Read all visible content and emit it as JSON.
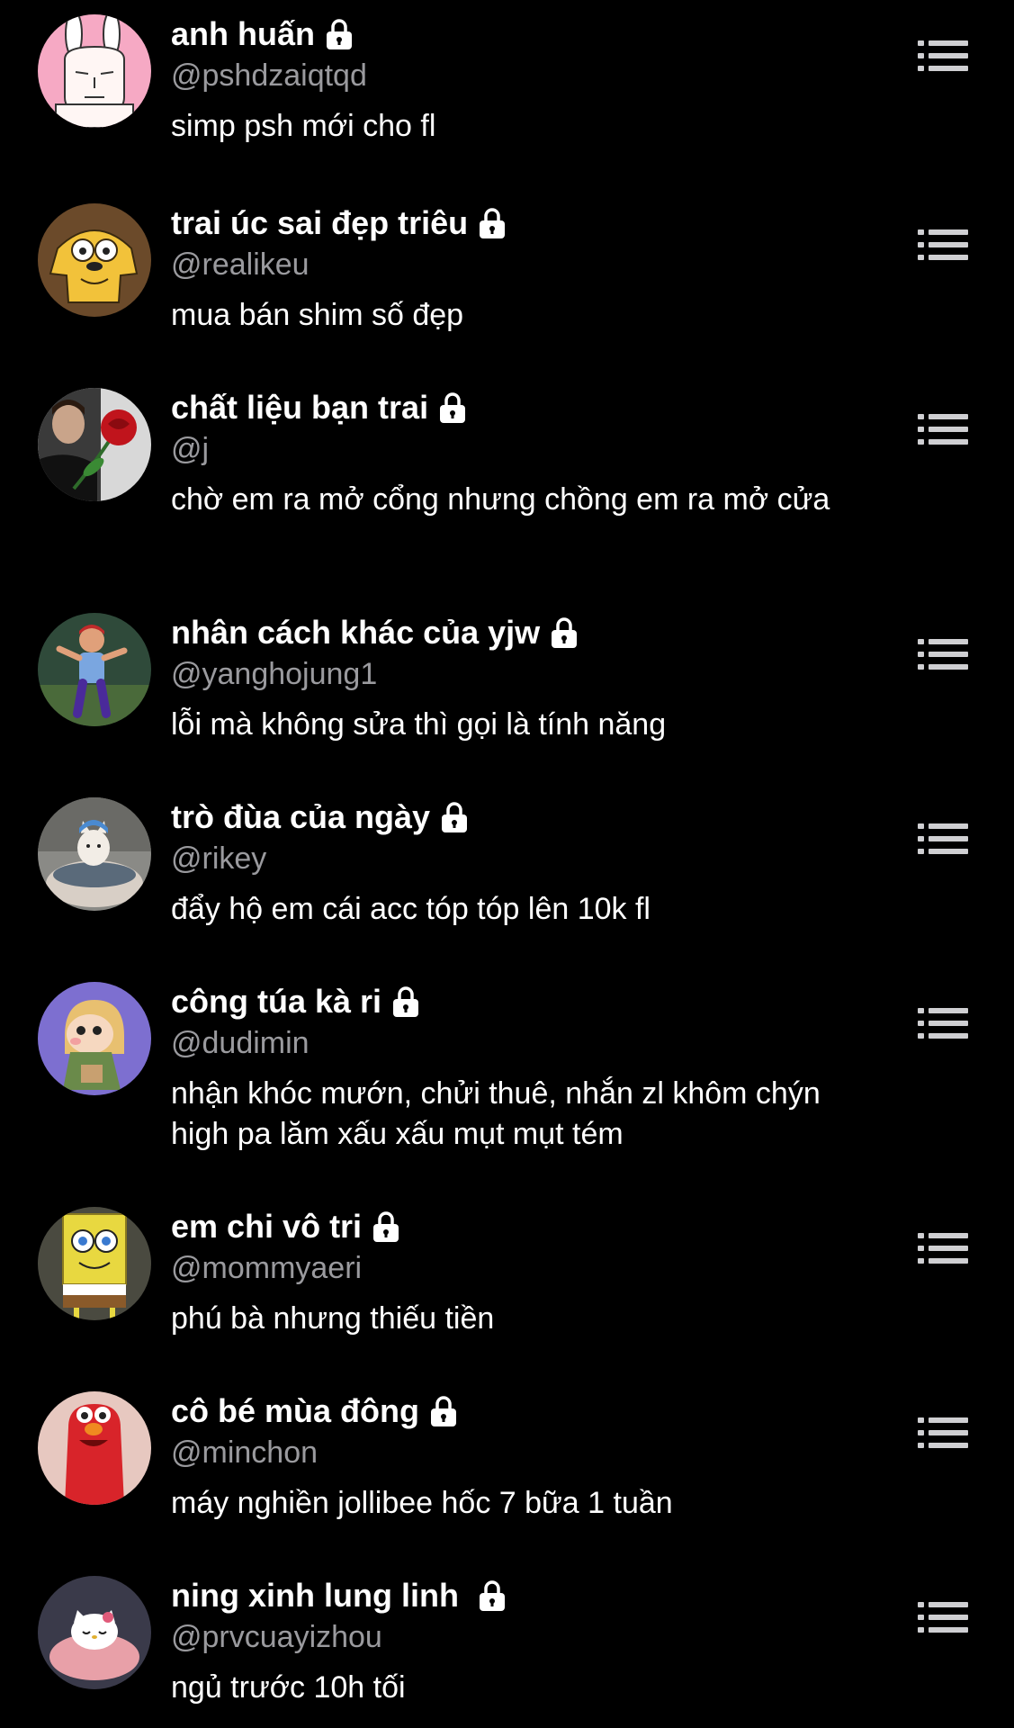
{
  "users": [
    {
      "name": "anh huấn",
      "handle": "@pshdzaiqtqd",
      "bio": "simp psh mới cho fl",
      "avatar_icon": "pink-rabbit-avatar",
      "avatar_bg": "#f6a9c4"
    },
    {
      "name": "trai úc sai đẹp triêu",
      "handle": "@realikeu",
      "bio": "mua bán shim số đẹp",
      "avatar_icon": "yellow-dog-avatar",
      "avatar_bg": "#6b4a2a"
    },
    {
      "name": "chất liệu bạn trai",
      "handle": "@j",
      "bio": "chờ em ra mở cổng nhưng chồng em ra mở cửa",
      "avatar_icon": "man-with-rose-avatar",
      "avatar_bg": "#2a2a2a"
    },
    {
      "name": "nhân cách khác của yjw",
      "handle": "@yanghojung1",
      "bio": "lỗi mà không sửa thì gọi là tính năng",
      "avatar_icon": "dancing-boy-avatar",
      "avatar_bg": "#2f4a3a"
    },
    {
      "name": "trò đùa của ngày",
      "handle": "@rikey",
      "bio": "đẩy hộ em cái acc tóp tóp lên 10k fl",
      "avatar_icon": "cat-in-bowl-avatar",
      "avatar_bg": "#8a8a86"
    },
    {
      "name": "công túa kà ri",
      "handle": "@dudimin",
      "bio": "nhận khóc mướn, chửi thuê, nhắn zl khôm chýn high pa lăm xấu xấu mụt mụt tém",
      "avatar_icon": "cartoon-girl-avatar",
      "avatar_bg": "#7d6fd0"
    },
    {
      "name": "em chi vô tri",
      "handle": "@mommyaeri",
      "bio": "phú bà nhưng thiếu tiền",
      "avatar_icon": "sponge-avatar",
      "avatar_bg": "#d9c24a"
    },
    {
      "name": "cô bé mùa đông",
      "handle": "@minchon",
      "bio": "máy nghiền jollibee hốc 7 bữa 1 tuần",
      "avatar_icon": "red-monster-avatar",
      "avatar_bg": "#e7c8c0"
    },
    {
      "name": "ning xinh lung linh",
      "handle": "@prvcuayizhou",
      "bio": "ngủ trước 10h tối",
      "avatar_icon": "sleeping-kitty-avatar",
      "avatar_bg": "#3a3a4a"
    }
  ],
  "colors": {
    "background": "#000000",
    "primary_text": "#ffffff",
    "secondary_text": "#9a9a9e",
    "menu_icon": "#cfcfd2"
  },
  "icons": {
    "lock": "lock-icon",
    "menu": "list-menu-icon"
  }
}
